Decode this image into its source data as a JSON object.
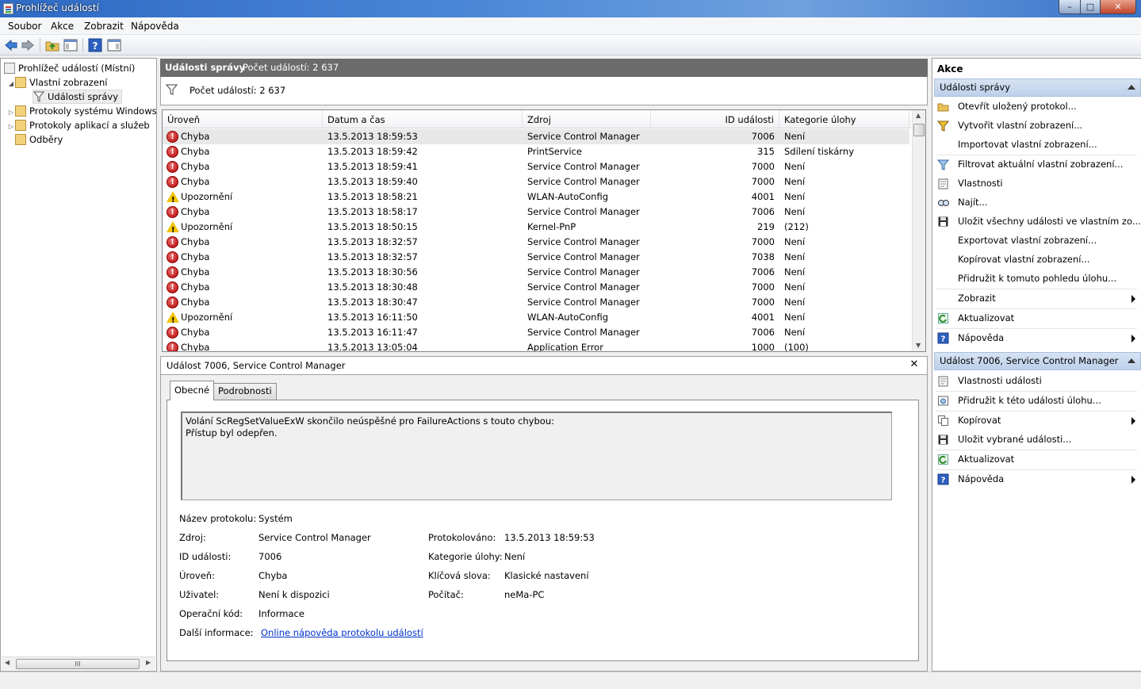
{
  "window": {
    "title": "Prohlížeč událostí",
    "min_glyph": "–",
    "max_glyph": "□",
    "close_glyph": "✕"
  },
  "menu": [
    "Soubor",
    "Akce",
    "Zobrazit",
    "Nápověda"
  ],
  "toolbar": {
    "icons": [
      "back-icon",
      "forward-icon",
      "up-folder-icon",
      "show-hide-console-tree-icon",
      "help-icon",
      "show-hide-action-pane-icon"
    ]
  },
  "tree": {
    "root": "Prohlížeč událostí (Místní)",
    "custom_views": "Vlastní zobrazení",
    "admin_events": "Události správy",
    "windows_logs": "Protokoly systému Windows",
    "app_logs": "Protokoly aplikací a služeb",
    "subscriptions": "Odběry",
    "scroll_grip": "III"
  },
  "center": {
    "header_title": "Události správy",
    "header_count": "Počet událostí: 2 637",
    "filter_text": "Počet událostí: 2 637"
  },
  "grid": {
    "columns": [
      "Úroveň",
      "Datum a čas",
      "Zdroj",
      "ID události",
      "Kategorie úlohy"
    ],
    "rows": [
      {
        "level": "Chyba",
        "type": "error",
        "date": "13.5.2013 18:59:53",
        "source": "Service Control Manager",
        "id": "7006",
        "category": "Není"
      },
      {
        "level": "Chyba",
        "type": "error",
        "date": "13.5.2013 18:59:42",
        "source": "PrintService",
        "id": "315",
        "category": "Sdílení tiskárny"
      },
      {
        "level": "Chyba",
        "type": "error",
        "date": "13.5.2013 18:59:41",
        "source": "Service Control Manager",
        "id": "7000",
        "category": "Není"
      },
      {
        "level": "Chyba",
        "type": "error",
        "date": "13.5.2013 18:59:40",
        "source": "Service Control Manager",
        "id": "7000",
        "category": "Není"
      },
      {
        "level": "Upozornění",
        "type": "warning",
        "date": "13.5.2013 18:58:21",
        "source": "WLAN-AutoConfig",
        "id": "4001",
        "category": "Není"
      },
      {
        "level": "Chyba",
        "type": "error",
        "date": "13.5.2013 18:58:17",
        "source": "Service Control Manager",
        "id": "7006",
        "category": "Není"
      },
      {
        "level": "Upozornění",
        "type": "warning",
        "date": "13.5.2013 18:50:15",
        "source": "Kernel-PnP",
        "id": "219",
        "category": "(212)"
      },
      {
        "level": "Chyba",
        "type": "error",
        "date": "13.5.2013 18:32:57",
        "source": "Service Control Manager",
        "id": "7000",
        "category": "Není"
      },
      {
        "level": "Chyba",
        "type": "error",
        "date": "13.5.2013 18:32:57",
        "source": "Service Control Manager",
        "id": "7038",
        "category": "Není"
      },
      {
        "level": "Chyba",
        "type": "error",
        "date": "13.5.2013 18:30:56",
        "source": "Service Control Manager",
        "id": "7006",
        "category": "Není"
      },
      {
        "level": "Chyba",
        "type": "error",
        "date": "13.5.2013 18:30:48",
        "source": "Service Control Manager",
        "id": "7000",
        "category": "Není"
      },
      {
        "level": "Chyba",
        "type": "error",
        "date": "13.5.2013 18:30:47",
        "source": "Service Control Manager",
        "id": "7000",
        "category": "Není"
      },
      {
        "level": "Upozornění",
        "type": "warning",
        "date": "13.5.2013 16:11:50",
        "source": "WLAN-AutoConfig",
        "id": "4001",
        "category": "Není"
      },
      {
        "level": "Chyba",
        "type": "error",
        "date": "13.5.2013 16:11:47",
        "source": "Service Control Manager",
        "id": "7006",
        "category": "Není"
      },
      {
        "level": "Chyba",
        "type": "error",
        "date": "13.5.2013 13:05:04",
        "source": "Application Error",
        "id": "1000",
        "category": "(100)"
      }
    ]
  },
  "detail": {
    "title": "Událost 7006, Service Control Manager",
    "tabs": [
      "Obecné",
      "Podrobnosti"
    ],
    "description_line1": "Volání ScRegSetValueExW skončilo neúspěšné pro FailureActions s touto chybou:",
    "description_line2": "Přístup byl odepřen.",
    "fields": {
      "log_name_label": "Název protokolu:",
      "log_name": "Systém",
      "source_label": "Zdroj:",
      "source": "Service Control Manager",
      "logged_label": "Protokolováno:",
      "logged": "13.5.2013 18:59:53",
      "event_id_label": "ID události:",
      "event_id": "7006",
      "task_label": "Kategorie úlohy:",
      "task": "Není",
      "level_label": "Úroveň:",
      "level": "Chyba",
      "keywords_label": "Klíčová slova:",
      "keywords": "Klasické nastavení",
      "user_label": "Uživatel:",
      "user": "Není k dispozici",
      "computer_label": "Počítač:",
      "computer": "neMa-PC",
      "opcode_label": "Operační kód:",
      "opcode": "Informace",
      "more_info_label": "Další informace:",
      "more_info_link": "Online nápověda protokolu událostí"
    }
  },
  "actions": {
    "title": "Akce",
    "section1": "Události správy",
    "items1": [
      {
        "label": "Otevřít uložený protokol...",
        "icon": "open-folder-icon",
        "submenu": false
      },
      {
        "label": "Vytvořit vlastní zobrazení...",
        "icon": "create-filter-icon",
        "submenu": false
      },
      {
        "label": "Importovat vlastní zobrazení...",
        "icon": "",
        "submenu": false
      },
      {
        "label": "Filtrovat aktuální vlastní zobrazení...",
        "icon": "filter-icon",
        "submenu": false
      },
      {
        "label": "Vlastnosti",
        "icon": "properties-icon",
        "submenu": false
      },
      {
        "label": "Najít...",
        "icon": "find-icon",
        "submenu": false
      },
      {
        "label": "Uložit všechny události ve vlastním zo...",
        "icon": "save-icon",
        "submenu": false
      },
      {
        "label": "Exportovat vlastní zobrazení...",
        "icon": "",
        "submenu": false
      },
      {
        "label": "Kopírovat vlastní zobrazení...",
        "icon": "",
        "submenu": false
      },
      {
        "label": "Přidružit k tomuto pohledu úlohu...",
        "icon": "",
        "submenu": false
      },
      {
        "label": "Zobrazit",
        "icon": "",
        "submenu": true
      },
      {
        "label": "Aktualizovat",
        "icon": "refresh-icon",
        "submenu": false
      },
      {
        "label": "Nápověda",
        "icon": "help-icon",
        "submenu": true
      }
    ],
    "section2": "Událost 7006, Service Control Manager",
    "items2": [
      {
        "label": "Vlastnosti události",
        "icon": "event-properties-icon",
        "submenu": false
      },
      {
        "label": "Přidružit k této události úlohu...",
        "icon": "attach-task-icon",
        "submenu": false
      },
      {
        "label": "Kopírovat",
        "icon": "copy-icon",
        "submenu": true
      },
      {
        "label": "Uložit vybrané události...",
        "icon": "save-icon",
        "submenu": false
      },
      {
        "label": "Aktualizovat",
        "icon": "refresh-icon",
        "submenu": false
      },
      {
        "label": "Nápověda",
        "icon": "help-icon",
        "submenu": true
      }
    ]
  }
}
